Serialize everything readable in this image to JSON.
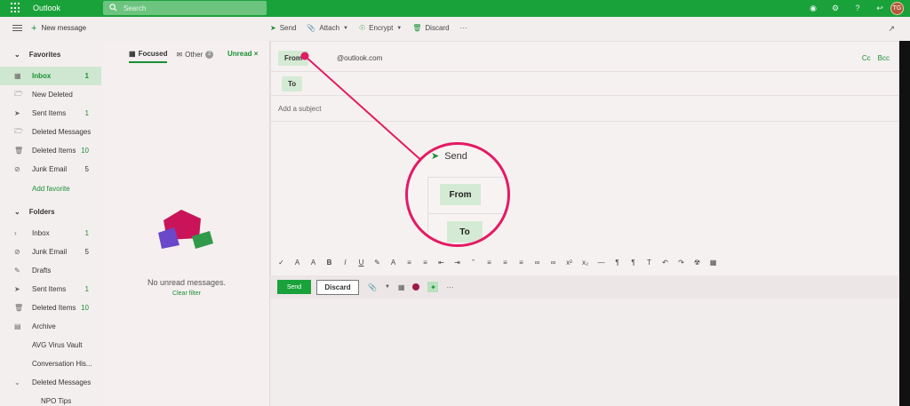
{
  "app": {
    "title": "Outlook",
    "search_placeholder": "Search",
    "avatar_initials": "TG"
  },
  "toolbar": {
    "new_message": "New message",
    "send": "Send",
    "attach": "Attach",
    "encrypt": "Encrypt",
    "discard": "Discard",
    "more": "···"
  },
  "nav": {
    "favorites_label": "Favorites",
    "favorites": [
      {
        "label": "Inbox",
        "count": "1",
        "icon": "inbox-icon",
        "selected": true
      },
      {
        "label": "New Deleted",
        "count": "",
        "icon": "folder-icon"
      },
      {
        "label": "Sent Items",
        "count": "1",
        "icon": "send-icon"
      },
      {
        "label": "Deleted Messages",
        "count": "",
        "icon": "folder-icon"
      },
      {
        "label": "Deleted Items",
        "count": "10",
        "icon": "trash-icon"
      },
      {
        "label": "Junk Email",
        "count": "5",
        "icon": "block-icon"
      }
    ],
    "add_favorite": "Add favorite",
    "folders_label": "Folders",
    "folders": [
      {
        "label": "Inbox",
        "count": "1",
        "icon": "chevron-right-icon"
      },
      {
        "label": "Junk Email",
        "count": "5",
        "icon": "block-icon"
      },
      {
        "label": "Drafts",
        "count": "",
        "icon": "pencil-icon"
      },
      {
        "label": "Sent Items",
        "count": "1",
        "icon": "send-icon"
      },
      {
        "label": "Deleted Items",
        "count": "10",
        "icon": "trash-icon"
      },
      {
        "label": "Archive",
        "count": "",
        "icon": "archive-icon"
      },
      {
        "label": "AVG Virus Vault",
        "count": "",
        "icon": "none"
      },
      {
        "label": "Conversation His...",
        "count": "",
        "icon": "none"
      },
      {
        "label": "Deleted Messages",
        "count": "",
        "icon": "chevron-down-icon"
      },
      {
        "label": "NPO Tips",
        "count": "",
        "icon": "none"
      }
    ]
  },
  "list": {
    "tab_focused": "Focused",
    "tab_other": "Other",
    "other_count": "2",
    "filter_unread": "Unread",
    "filter_close": "×",
    "empty_title": "No unread messages.",
    "clear_filter": "Clear filter"
  },
  "compose": {
    "from_label": "From",
    "from_address": "@outlook.com",
    "to_label": "To",
    "cc": "Cc",
    "bcc": "Bcc",
    "subject_placeholder": "Add a subject",
    "send_button": "Send",
    "discard_button": "Discard"
  },
  "callout": {
    "send": "Send",
    "from": "From",
    "to": "To"
  },
  "colors": {
    "brand": "#1aa23a",
    "accent": "#e41a63"
  }
}
